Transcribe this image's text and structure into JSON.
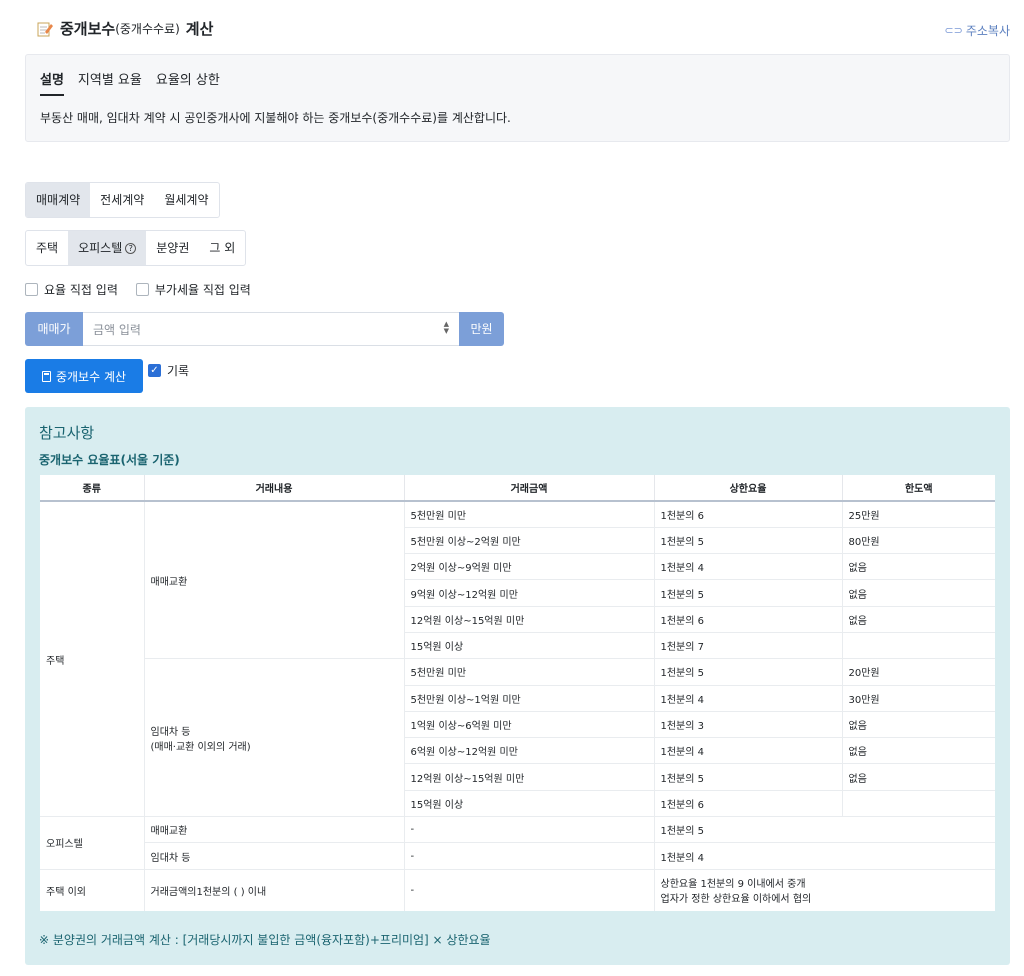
{
  "header": {
    "title_main": "중개보수",
    "title_sub": "(중개수수료)",
    "title_tail": "계산",
    "copy_link": "주소복사"
  },
  "description": {
    "tabs": [
      "설명",
      "지역별 요율",
      "요율의 상한"
    ],
    "text": "부동산 매매, 임대차 계약 시 공인중개사에 지불해야 하는 중개보수(중개수수료)를 계산합니다."
  },
  "contract_types": [
    "매매계약",
    "전세계약",
    "월세계약"
  ],
  "property_types": [
    "주택",
    "오피스텔",
    "분양권",
    "그 외"
  ],
  "options": {
    "rate_manual": "요율 직접 입력",
    "vat_manual": "부가세율 직접 입력"
  },
  "amount": {
    "prefix": "매매가",
    "placeholder": "금액 입력",
    "suffix": "만원"
  },
  "calc_button": "중개보수 계산",
  "record_label": "기록",
  "reference": {
    "title": "참고사항",
    "subtitle": "중개보수 요율표(서울 기준)",
    "headers": [
      "종류",
      "거래내용",
      "거래금액",
      "상한요율",
      "한도액"
    ],
    "housing": "주택",
    "trade": "매매교환",
    "lease_line1": "임대차 등",
    "lease_line2": "(매매·교환 이외의 거래)",
    "trade_rows": [
      [
        "5천만원 미만",
        "1천분의 6",
        "25만원"
      ],
      [
        "5천만원 이상~2억원 미만",
        "1천분의 5",
        "80만원"
      ],
      [
        "2억원 이상~9억원 미만",
        "1천분의 4",
        "없음"
      ],
      [
        "9억원 이상~12억원 미만",
        "1천분의 5",
        "없음"
      ],
      [
        "12억원 이상~15억원 미만",
        "1천분의 6",
        "없음"
      ],
      [
        "15억원 이상",
        "1천분의 7",
        ""
      ]
    ],
    "lease_rows": [
      [
        "5천만원 미만",
        "1천분의 5",
        "20만원"
      ],
      [
        "5천만원 이상~1억원 미만",
        "1천분의 4",
        "30만원"
      ],
      [
        "1억원 이상~6억원 미만",
        "1천분의 3",
        "없음"
      ],
      [
        "6억원 이상~12억원 미만",
        "1천분의 4",
        "없음"
      ],
      [
        "12억원 이상~15억원 미만",
        "1천분의 5",
        "없음"
      ],
      [
        "15억원 이상",
        "1천분의 6",
        ""
      ]
    ],
    "officetel": "오피스텔",
    "officetel_rows": [
      [
        "매매교환",
        "-",
        "1천분의 5"
      ],
      [
        "임대차 등",
        "-",
        "1천분의 4"
      ]
    ],
    "other": "주택 이외",
    "other_content": "거래금액의1천분의 ( ) 이내",
    "other_amount": "-",
    "other_rate_line1": "상한요율 1천분의 9 이내에서 중개",
    "other_rate_line2": "업자가 정한 상한요율 이하에서 협의",
    "note": "※ 분양권의 거래금액 계산 : [거래당시까지 불입한 금액(융자포함)+프리미엄] × 상한요율"
  }
}
